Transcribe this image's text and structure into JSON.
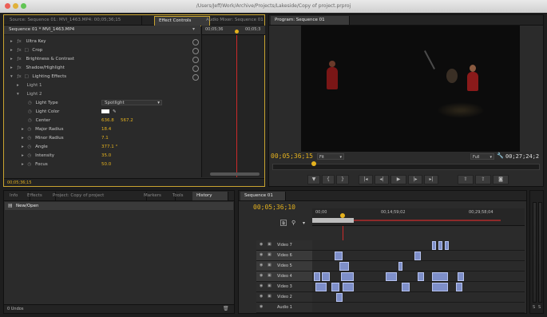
{
  "window": {
    "title": "/Users/Jeff/Work/Archive/Projects/Lakeside/Copy of project.prproj"
  },
  "colors": {
    "accent_yellow": "#e5b21e",
    "playhead_red": "#cc2a2a",
    "clip_blue": "#7e8fc9",
    "panel_bg": "#2b2b2b"
  },
  "source_panel": {
    "tabs": [
      {
        "label": "Source: Sequence 01: MVI_1463.MP4: 00;05;36;15"
      },
      {
        "label": "Effect Controls"
      },
      {
        "label": "Audio Mixer: Sequence 01"
      }
    ],
    "sequence_header": "Sequence 01 * MVI_1463.MP4",
    "ruler_start": "00;05;36",
    "ruler_end": "00;05;3",
    "effects": [
      {
        "label": "Ultra Key"
      },
      {
        "label": "Crop"
      },
      {
        "label": "Brightness & Contrast"
      },
      {
        "label": "Shadow/Highlight"
      },
      {
        "label": "Lighting Effects"
      }
    ],
    "lights": [
      {
        "label": "Light 1"
      },
      {
        "label": "Light 2"
      }
    ],
    "params": [
      {
        "label": "Light Type",
        "value": "Spotlight"
      },
      {
        "label": "Light Color",
        "value": ""
      },
      {
        "label": "Center",
        "value": "636.8",
        "value2": "567.2"
      },
      {
        "label": "Major Radius",
        "value": "18.4"
      },
      {
        "label": "Minor Radius",
        "value": "7.1"
      },
      {
        "label": "Angle",
        "value": "377.1 °"
      },
      {
        "label": "Intensity",
        "value": "35.0"
      },
      {
        "label": "Focus",
        "value": "50.0"
      }
    ],
    "footer_timecode": "00;05;36;15"
  },
  "program_monitor": {
    "tab_label": "Program: Sequence 01",
    "current_timecode": "00;05;36;15",
    "zoom": "Fit",
    "resolution": "Full",
    "duration": "00;27;24;2"
  },
  "project_panel": {
    "tabs": [
      {
        "label": "Info"
      },
      {
        "label": "Effects"
      },
      {
        "label": "Project: Copy of project"
      },
      {
        "label": "Markers"
      },
      {
        "label": "Tools"
      },
      {
        "label": "History"
      }
    ],
    "item": "New/Open",
    "footer": "0 Undos"
  },
  "timeline": {
    "tab_label": "Sequence 01",
    "timecode": "00;05;36;10",
    "ruler_labels": [
      "00;00",
      "00;14;59;02",
      "00;29;58;04"
    ],
    "tracks": [
      {
        "label": "Video 7"
      },
      {
        "label": "Video 6"
      },
      {
        "label": "Video 5"
      },
      {
        "label": "Video 4"
      },
      {
        "label": "Video 3"
      },
      {
        "label": "Video 2"
      },
      {
        "label": "Audio 1"
      }
    ],
    "meter_labels": [
      "S",
      "S"
    ]
  }
}
